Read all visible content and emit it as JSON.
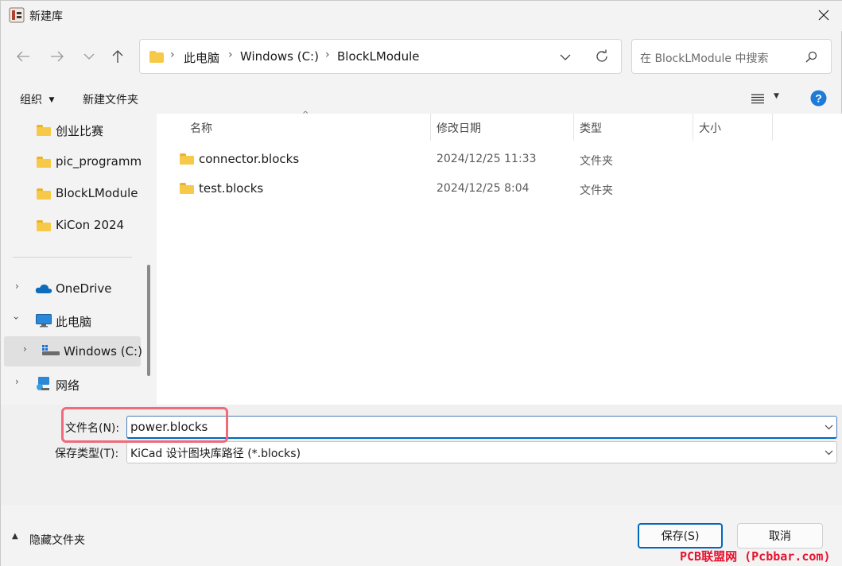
{
  "window": {
    "title": "新建库"
  },
  "address": {
    "segments": [
      "此电脑",
      "Windows (C:)",
      "BlockLModule"
    ]
  },
  "search": {
    "placeholder": "在 BlockLModule 中搜索"
  },
  "commands": {
    "organize": "组织",
    "new_folder": "新建文件夹"
  },
  "sidebar": {
    "quick_items": [
      "创业比赛",
      "pic_programm",
      "BlockLModule",
      "KiCon 2024"
    ],
    "onedrive": "OneDrive",
    "this_pc": "此电脑",
    "windows_c": "Windows (C:)",
    "network": "网络"
  },
  "columns": {
    "name": "名称",
    "modified": "修改日期",
    "type": "类型",
    "size": "大小"
  },
  "files": [
    {
      "name": "connector.blocks",
      "modified": "2024/12/25 11:33",
      "type": "文件夹"
    },
    {
      "name": "test.blocks",
      "modified": "2024/12/25 8:04",
      "type": "文件夹"
    }
  ],
  "form": {
    "filename_label": "文件名(N):",
    "filename_value": "power.blocks",
    "filetype_label": "保存类型(T):",
    "filetype_value": "KiCad 设计图块库路径 (*.blocks)"
  },
  "footer": {
    "hide_folders": "隐藏文件夹",
    "save": "保存(S)",
    "cancel": "取消"
  },
  "watermark": "PCB联盟网 (Pcbbar.com)",
  "colors": {
    "accent": "#0067c0",
    "highlight": "#f06a7a",
    "folder": "#f7c948",
    "watermark": "#e8112d"
  }
}
